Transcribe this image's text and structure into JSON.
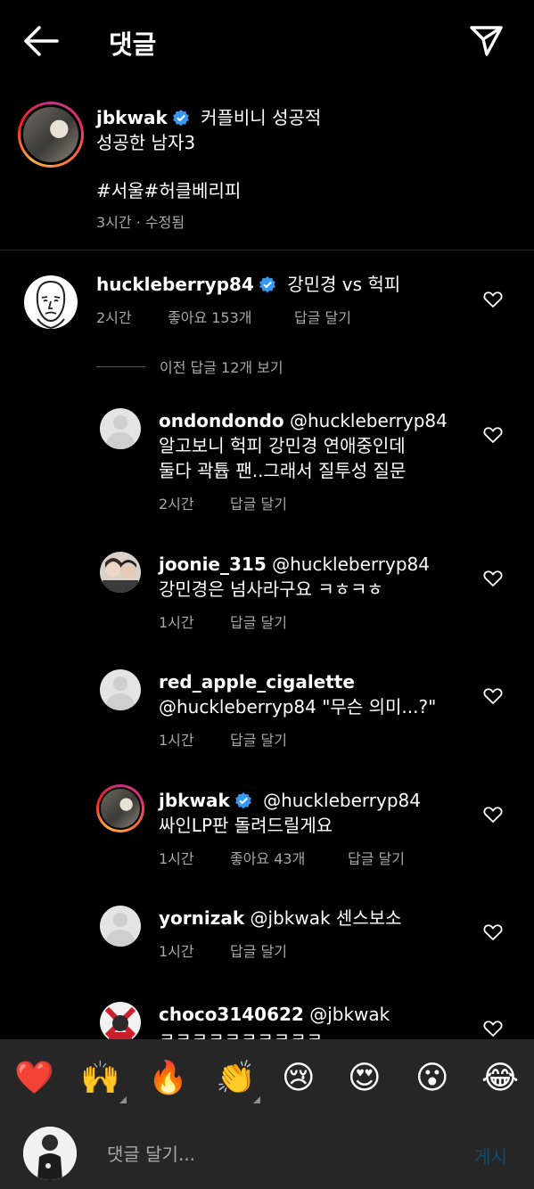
{
  "header": {
    "title": "댓글"
  },
  "caption": {
    "username": "jbkwak",
    "text": "커플비니 성공적",
    "line2": "성공한 남자3",
    "hashtags": "#서울#허클베리피",
    "meta": "3시간 · 수정됨"
  },
  "top_comment": {
    "username": "huckleberryp84",
    "text": "강민경 vs 헉피",
    "time": "2시간",
    "likes": "좋아요 153개",
    "reply": "답글 달기"
  },
  "view_replies": "이전 답글 12개 보기",
  "replies": [
    {
      "username": "ondondondo",
      "mention": "@huckleberryp84",
      "line1": "알고보니 헉피 강민경 연애중인데",
      "line2": "둘다 곽튭 팬..그래서 질투성 질문",
      "time": "2시간",
      "reply": "답글 달기"
    },
    {
      "username": "joonie_315",
      "mention": "@huckleberryp84",
      "line1": "강민경은 넘사라구요 ㅋㅎㅋㅎ",
      "time": "1시간",
      "reply": "답글 달기"
    },
    {
      "username": "red_apple_cigalette",
      "mention": "@huckleberryp84",
      "line1": "\"무슨 의미...?\"",
      "time": "1시간",
      "reply": "답글 달기"
    },
    {
      "username": "jbkwak",
      "mention": "@huckleberryp84",
      "line1": "싸인LP판 돌려드릴게요",
      "time": "1시간",
      "likes": "좋아요 43개",
      "reply": "답글 달기"
    },
    {
      "username": "yornizak",
      "mention": "@jbkwak",
      "line1": "센스보소",
      "time": "1시간",
      "reply": "답글 달기"
    },
    {
      "username": "choco3140622",
      "mention": "@jbkwak",
      "line1": "ㅋㅋㅋㅋㅋㅋㅋㅋㅋㅋ"
    }
  ],
  "emoji_bar": [
    "❤️",
    "🙌",
    "🔥",
    "👏",
    "😢",
    "😍",
    "😮",
    "😂"
  ],
  "input": {
    "placeholder": "댓글 달기...",
    "post": "게시"
  },
  "colors": {
    "verified": "#3897f0",
    "muted": "#a8a8a8",
    "post_disabled": "#0b4e7a",
    "bar": "#262626"
  }
}
